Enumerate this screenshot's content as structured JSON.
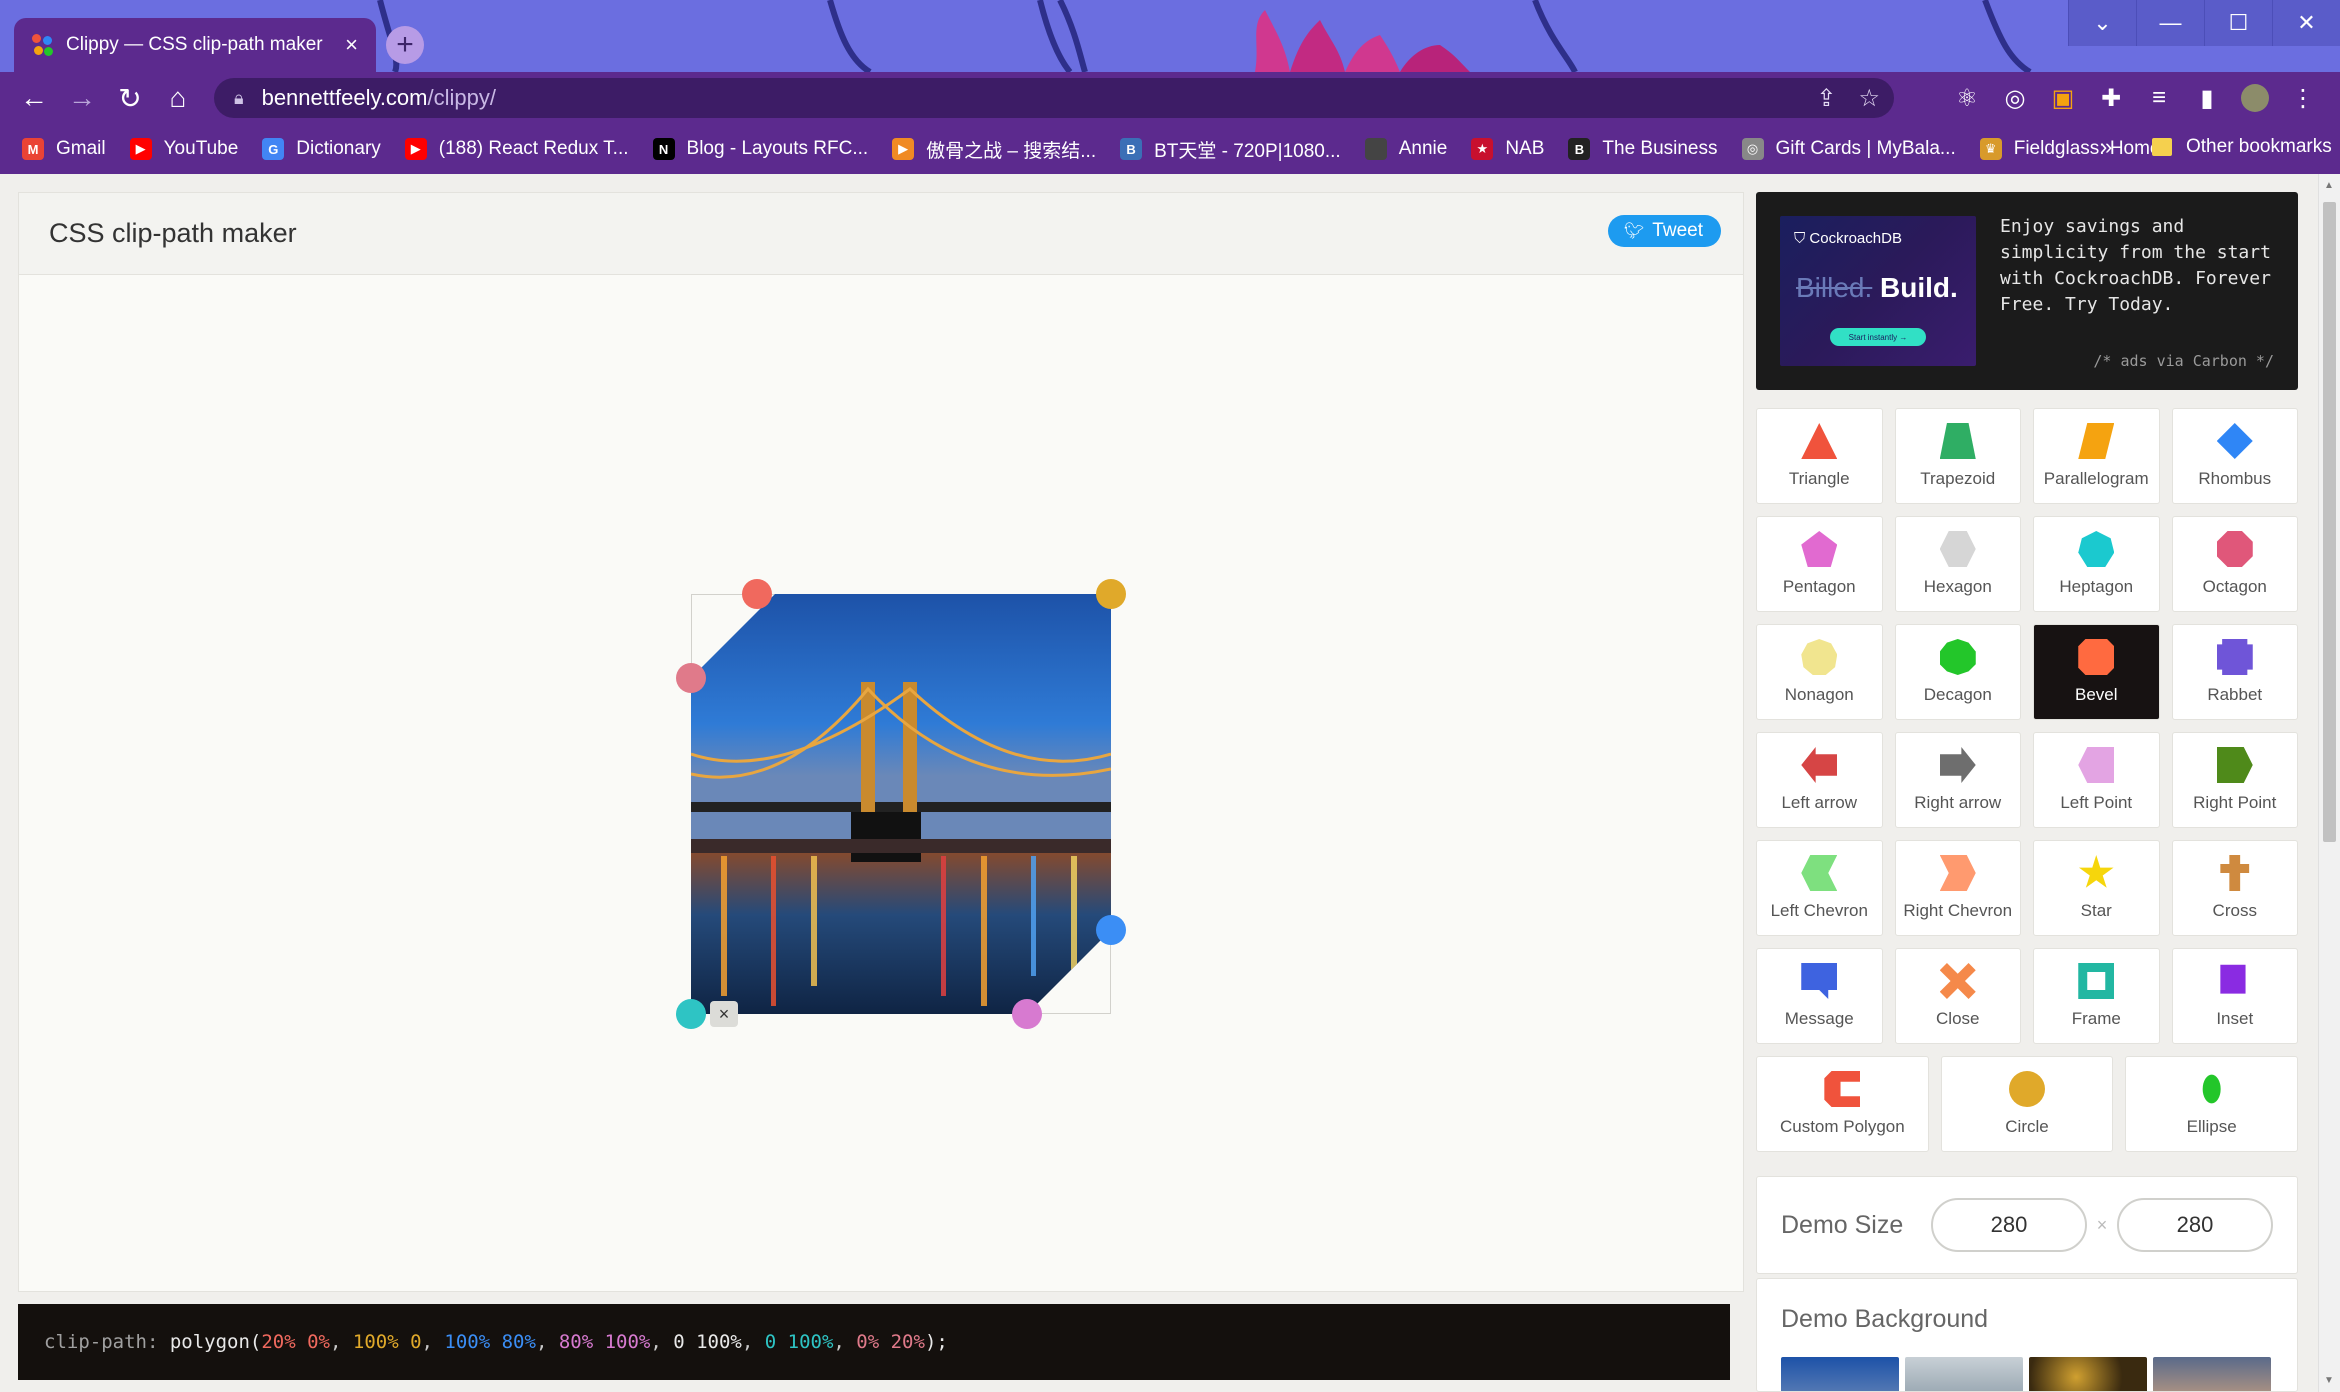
{
  "browser": {
    "tab_title": "Clippy — CSS clip-path maker",
    "tab_close": "×",
    "new_tab": "+",
    "url_host": "bennettfeely.com",
    "url_path": "/clippy/",
    "window_controls": [
      "⌄",
      "—",
      "☐",
      "✕"
    ],
    "bookmarks": [
      {
        "label": "Gmail",
        "icon": "gmail-icon",
        "color": "#ea4335",
        "glyph": "M"
      },
      {
        "label": "YouTube",
        "icon": "youtube-icon",
        "color": "#ff0000",
        "glyph": "▶"
      },
      {
        "label": "Dictionary",
        "icon": "google-icon",
        "color": "#4285f4",
        "glyph": "G"
      },
      {
        "label": "(188) React Redux T...",
        "icon": "youtube-icon",
        "color": "#ff0000",
        "glyph": "▶"
      },
      {
        "label": "Blog - Layouts RFC...",
        "icon": "nextjs-icon",
        "color": "#000000",
        "glyph": "N"
      },
      {
        "label": "傲骨之战 – 搜索结...",
        "icon": "play-icon",
        "color": "#f08a24",
        "glyph": "▶"
      },
      {
        "label": "BT天堂 - 720P|1080...",
        "icon": "bt-icon",
        "color": "#3b6fb6",
        "glyph": "B"
      },
      {
        "label": "Annie",
        "icon": "annie-icon",
        "color": "#444444",
        "glyph": ""
      },
      {
        "label": "NAB",
        "icon": "nab-icon",
        "color": "#c8102e",
        "glyph": "★"
      },
      {
        "label": "The Business",
        "icon": "business-icon",
        "color": "#222222",
        "glyph": "B"
      },
      {
        "label": "Gift Cards | MyBala...",
        "icon": "giftcard-icon",
        "color": "#888888",
        "glyph": "◎"
      },
      {
        "label": "Fieldglass: Home",
        "icon": "fieldglass-icon",
        "color": "#d89a2b",
        "glyph": "♛"
      }
    ],
    "bookmarks_more": "»",
    "other_bookmarks": "Other bookmarks"
  },
  "page": {
    "title": "CSS clip-path maker",
    "tweet_label": "Tweet"
  },
  "code": {
    "property": "clip-path:",
    "func": "polygon(",
    "points": [
      {
        "text": "20% 0%",
        "color": "#f0695e"
      },
      {
        "text": "100% 0",
        "color": "#e0a92a"
      },
      {
        "text": "100% 80%",
        "color": "#3b8ef5"
      },
      {
        "text": "80% 100%",
        "color": "#d77ad0"
      },
      {
        "text": "0 100%",
        "color": "#e8e8e8"
      },
      {
        "text": "0 100%",
        "color": "#2ec4c4"
      },
      {
        "text": "0% 20%",
        "color": "#e07a8a"
      }
    ],
    "close": ");"
  },
  "ad": {
    "brand": "CockroachDB",
    "headline_struck": "Billed.",
    "headline": "Build.",
    "cta": "Start instantly →",
    "text": "Enjoy savings and simplicity from the start with CockroachDB. Forever Free. Try Today.",
    "via": "/* ads via Carbon */"
  },
  "shapes": [
    [
      {
        "label": "Triangle",
        "color": "#f0533c",
        "clip": "polygon(50% 0%, 0% 100%, 100% 100%)"
      },
      {
        "label": "Trapezoid",
        "color": "#2fae64",
        "clip": "polygon(20% 0%, 80% 0%, 100% 100%, 0% 100%)"
      },
      {
        "label": "Parallelogram",
        "color": "#f5a310",
        "clip": "polygon(25% 0%, 100% 0%, 75% 100%, 0% 100%)"
      },
      {
        "label": "Rhombus",
        "color": "#2f86f6",
        "clip": "polygon(50% 0%, 100% 50%, 50% 100%, 0% 50%)"
      }
    ],
    [
      {
        "label": "Pentagon",
        "color": "#e16ad0",
        "clip": "polygon(50% 0%, 100% 38%, 82% 100%, 18% 100%, 0% 38%)"
      },
      {
        "label": "Hexagon",
        "color": "#d6d6d6",
        "clip": "polygon(25% 0%, 75% 0%, 100% 50%, 75% 100%, 25% 100%, 0% 50%)"
      },
      {
        "label": "Heptagon",
        "color": "#1bc9cf",
        "clip": "polygon(50% 0%, 90% 20%, 100% 60%, 75% 100%, 25% 100%, 0% 60%, 10% 20%)"
      },
      {
        "label": "Octagon",
        "color": "#e0577a",
        "clip": "polygon(30% 0%, 70% 0%, 100% 30%, 100% 70%, 70% 100%, 30% 100%, 0% 70%, 0% 30%)"
      }
    ],
    [
      {
        "label": "Nonagon",
        "color": "#f1e58f",
        "clip": "polygon(50% 0%, 83% 12%, 100% 43%, 94% 78%, 68% 100%, 32% 100%, 6% 78%, 0% 43%, 17% 12%)"
      },
      {
        "label": "Decagon",
        "color": "#23c62a",
        "clip": "polygon(50% 0%, 80% 10%, 100% 35%, 100% 70%, 80% 90%, 50% 100%, 20% 90%, 0% 70%, 0% 35%, 20% 10%)"
      },
      {
        "label": "Bevel",
        "color": "#ff6a40",
        "clip": "polygon(20% 0%, 80% 0%, 100% 20%, 100% 80%, 80% 100%, 20% 100%, 0% 80%, 0% 20%)",
        "active": true
      },
      {
        "label": "Rabbet",
        "color": "#6f55d8",
        "clip": "polygon(0% 15%, 15% 15%, 15% 0%, 85% 0%, 85% 15%, 100% 15%, 100% 85%, 85% 85%, 85% 100%, 15% 100%, 15% 85%, 0% 85%)"
      }
    ],
    [
      {
        "label": "Left arrow",
        "color": "#d64545",
        "clip": "polygon(40% 0%, 40% 20%, 100% 20%, 100% 80%, 40% 80%, 40% 100%, 0% 50%)"
      },
      {
        "label": "Right arrow",
        "color": "#6e6e6e",
        "clip": "polygon(0% 20%, 60% 20%, 60% 0%, 100% 50%, 60% 100%, 60% 80%, 0% 80%)"
      },
      {
        "label": "Left Point",
        "color": "#e3a4e3",
        "clip": "polygon(25% 0%, 100% 0%, 100% 100%, 25% 100%, 0% 50%)"
      },
      {
        "label": "Right Point",
        "color": "#4f8a1a",
        "clip": "polygon(0% 0%, 75% 0%, 100% 50%, 75% 100%, 0% 100%)"
      }
    ],
    [
      {
        "label": "Left Chevron",
        "color": "#7ee07f",
        "clip": "polygon(100% 0%, 75% 50%, 100% 100%, 25% 100%, 0% 50%, 25% 0%)"
      },
      {
        "label": "Right Chevron",
        "color": "#ff9a6f",
        "clip": "polygon(75% 0%, 100% 50%, 75% 100%, 0% 100%, 25% 50%, 0% 0%)"
      },
      {
        "label": "Star",
        "color": "#f6d60c",
        "clip": "polygon(50% 0%, 61% 35%, 98% 35%, 68% 57%, 79% 91%, 50% 70%, 21% 91%, 32% 57%, 2% 35%, 39% 35%)"
      },
      {
        "label": "Cross",
        "color": "#cf8a3f",
        "clip": "polygon(35% 0%, 65% 0%, 65% 25%, 90% 25%, 90% 50%, 65% 50%, 65% 100%, 35% 100%, 35% 50%, 10% 50%, 10% 25%, 35% 25%)"
      }
    ],
    [
      {
        "label": "Message",
        "color": "#3e63e0",
        "clip": "polygon(0% 0%, 100% 0%, 100% 75%, 75% 75%, 75% 100%, 50% 75%, 0% 75%)"
      },
      {
        "label": "Close",
        "color": "#f5894a",
        "clip": "polygon(20% 0%, 0% 20%, 30% 50%, 0% 80%, 20% 100%, 50% 70%, 80% 100%, 100% 80%, 70% 50%, 100% 20%, 80% 0%, 50% 30%)"
      },
      {
        "label": "Frame",
        "color": "#22b7a2",
        "clip": "polygon(0% 0%, 0% 100%, 25% 100%, 25% 25%, 75% 25%, 75% 75%, 25% 75%, 25% 100%, 100% 100%, 100% 0%)"
      },
      {
        "label": "Inset",
        "color": "#8a2be2",
        "clip": "inset(5% 20% 15% 10%)"
      }
    ],
    [
      {
        "label": "Custom Polygon",
        "color": "#f0533c",
        "clip": "polygon(20% 0%, 100% 0%, 100% 30%, 45% 30%, 45% 70%, 100% 70%, 100% 100%, 20% 100%, 0% 80%, 0% 20%)"
      },
      {
        "label": "Circle",
        "color": "#e0a92a",
        "clip": "circle(50% at 50% 50%)"
      },
      {
        "label": "Ellipse",
        "color": "#23c62a",
        "clip": "ellipse(25% 40% at 50% 50%)"
      }
    ]
  ],
  "demo_size": {
    "label": "Demo Size",
    "width": "280",
    "height": "280",
    "separator": "×"
  },
  "demo_background": {
    "label": "Demo Background"
  },
  "handles": [
    {
      "name": "handle-top-left-edge",
      "color": "#f0695e"
    },
    {
      "name": "handle-top-right",
      "color": "#e0a92a"
    },
    {
      "name": "handle-right-edge",
      "color": "#3b8ef5"
    },
    {
      "name": "handle-bottom-edge",
      "color": "#d77ad0"
    },
    {
      "name": "handle-bottom-left",
      "color": "#2ec4c4"
    },
    {
      "name": "handle-left-edge",
      "color": "#e07a8a"
    }
  ],
  "remove_point_label": "×"
}
